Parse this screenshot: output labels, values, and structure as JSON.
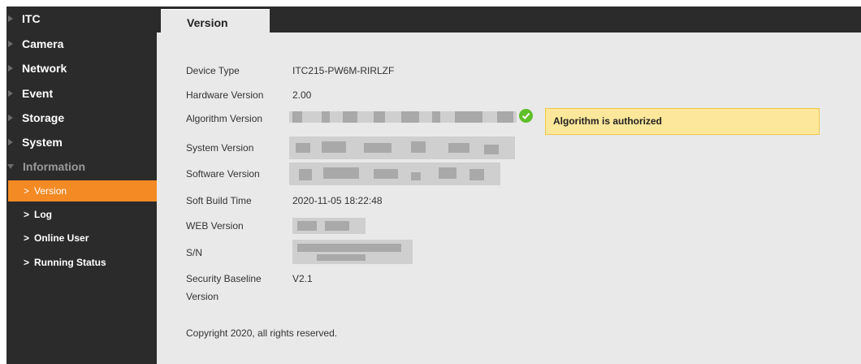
{
  "sidebar": {
    "sections": [
      {
        "label": "ITC"
      },
      {
        "label": "Camera"
      },
      {
        "label": "Network"
      },
      {
        "label": "Event"
      },
      {
        "label": "Storage"
      },
      {
        "label": "System"
      },
      {
        "label": "Information"
      }
    ],
    "info_items": [
      {
        "label": "Version",
        "active": true
      },
      {
        "label": "Log"
      },
      {
        "label": "Online User"
      },
      {
        "label": "Running Status"
      }
    ],
    "chevron": ">"
  },
  "tabs": [
    {
      "label": "Version"
    }
  ],
  "version_info": {
    "device_type": {
      "label": "Device Type",
      "value": "ITC215-PW6M-RIRLZF"
    },
    "hardware_version": {
      "label": "Hardware Version",
      "value": "2.00"
    },
    "algorithm_version": {
      "label": "Algorithm Version"
    },
    "system_version": {
      "label": "System Version"
    },
    "software_version": {
      "label": "Software Version"
    },
    "soft_build_time": {
      "label": "Soft Build Time",
      "value": "2020-11-05 18:22:48"
    },
    "web_version": {
      "label": "WEB Version"
    },
    "sn": {
      "label": "S/N"
    },
    "security_baseline": {
      "label_line1": "Security Baseline",
      "label_line2": "Version",
      "value": "V2.1"
    }
  },
  "algorithm_status": {
    "message": "Algorithm is authorized",
    "icon": "check-circle-icon",
    "color": "#5fbf28"
  },
  "footer": {
    "copyright": "Copyright 2020, all rights reserved."
  },
  "colors": {
    "accent": "#f38a24",
    "sidebar_bg": "#2b2b2b",
    "content_bg": "#e9e9e9",
    "notice_bg": "#fde79a"
  }
}
